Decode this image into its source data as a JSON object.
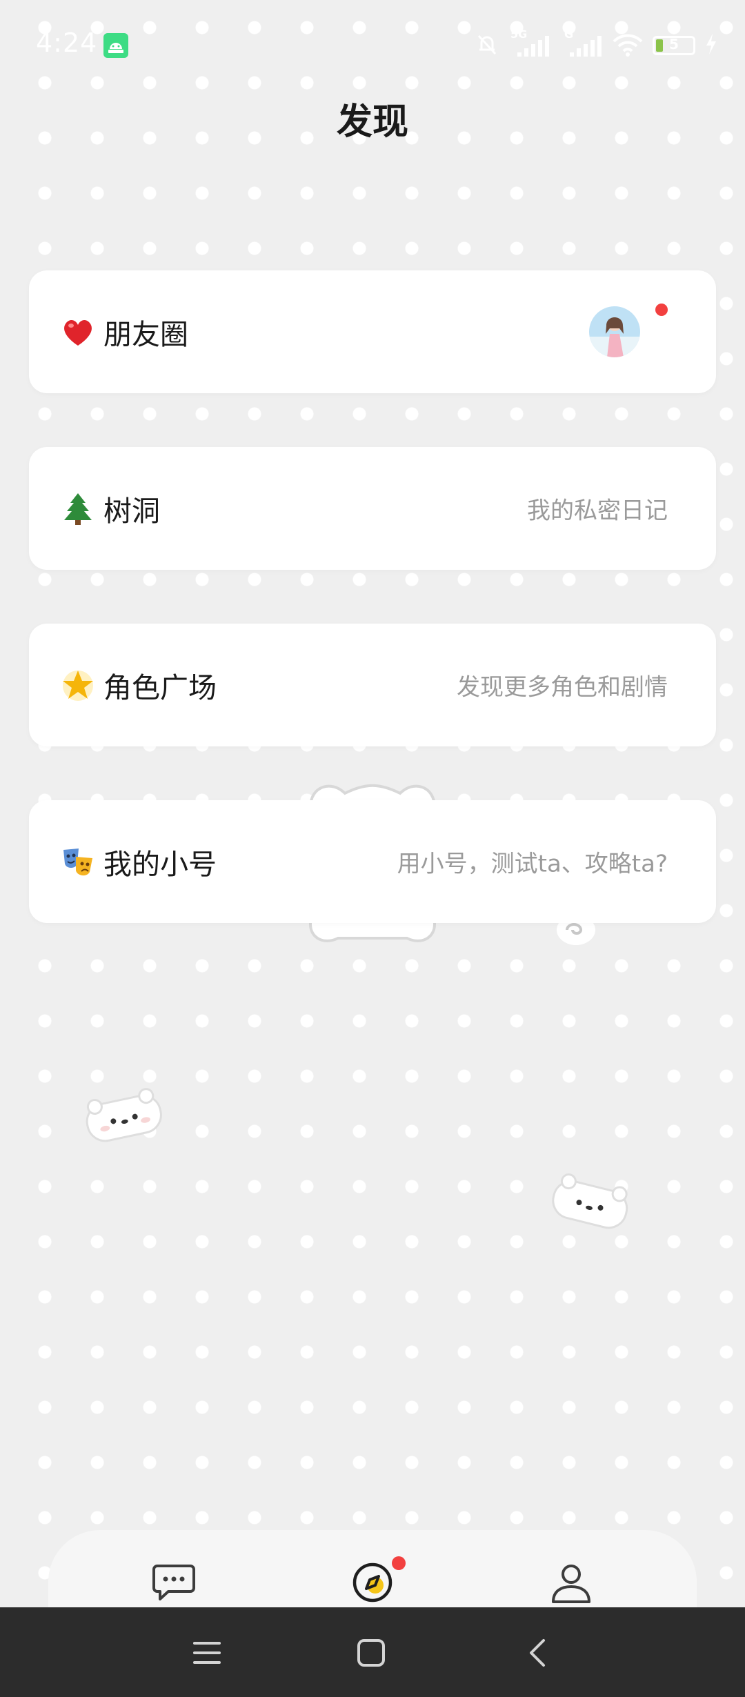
{
  "status_bar": {
    "time": "4:24",
    "network_5g": "5G",
    "network_g": "G",
    "battery_level": "5",
    "battery_fraction": 0.05
  },
  "header": {
    "title": "发现"
  },
  "cards": [
    {
      "emoji": "heart",
      "label": "朋友圈",
      "subtitle": "",
      "has_avatar": true,
      "has_dot": true
    },
    {
      "emoji": "evergreen-tree",
      "label": "树洞",
      "subtitle": "我的私密日记"
    },
    {
      "emoji": "glowing-star",
      "label": "角色广场",
      "subtitle": "发现更多角色和剧情"
    },
    {
      "emoji": "performing-arts",
      "label": "我的小号",
      "subtitle": "用小号，测试ta、攻略ta?"
    }
  ],
  "tab_bar": {
    "tabs": [
      {
        "icon": "chat-bubble-icon",
        "active": false
      },
      {
        "icon": "compass-icon",
        "active": true,
        "badge": true
      },
      {
        "icon": "profile-icon",
        "active": false
      }
    ]
  },
  "nav_bar": {
    "buttons": [
      "menu-icon",
      "home-icon",
      "back-icon"
    ]
  },
  "colors": {
    "background": "#efefef",
    "dot": "#ffffff",
    "card": "#ffffff",
    "badge": "#f2403f",
    "battery": "#8bc34a",
    "compass_accent": "#f5c518",
    "nav_bar": "#2c2c2c"
  }
}
